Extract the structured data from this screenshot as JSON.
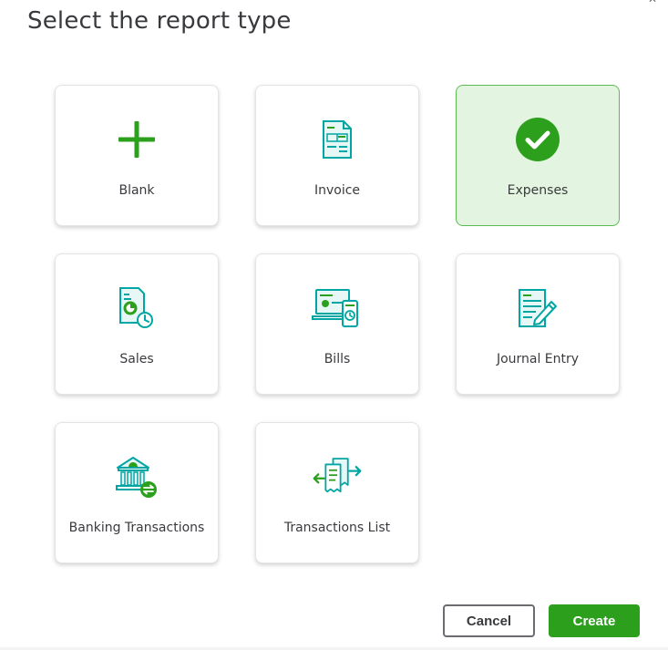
{
  "dialog": {
    "title": "Select the report type",
    "close_icon": "close-icon"
  },
  "report_types": [
    {
      "label": "Blank",
      "icon": "plus-icon",
      "selected": false
    },
    {
      "label": "Invoice",
      "icon": "invoice-icon",
      "selected": false
    },
    {
      "label": "Expenses",
      "icon": "checkmark-icon",
      "selected": true
    },
    {
      "label": "Sales",
      "icon": "sales-icon",
      "selected": false
    },
    {
      "label": "Bills",
      "icon": "bills-icon",
      "selected": false
    },
    {
      "label": "Journal Entry",
      "icon": "journal-entry-icon",
      "selected": false
    },
    {
      "label": "Banking Transactions",
      "icon": "bank-icon",
      "selected": false
    },
    {
      "label": "Transactions List",
      "icon": "transactions-list-icon",
      "selected": false
    }
  ],
  "footer": {
    "cancel_label": "Cancel",
    "create_label": "Create"
  },
  "colors": {
    "brand_green": "#2ca01c",
    "selected_bg": "#e3f5e1",
    "selected_border": "#5cba52",
    "icon_teal": "#00a6a4",
    "text": "#393a3d"
  }
}
